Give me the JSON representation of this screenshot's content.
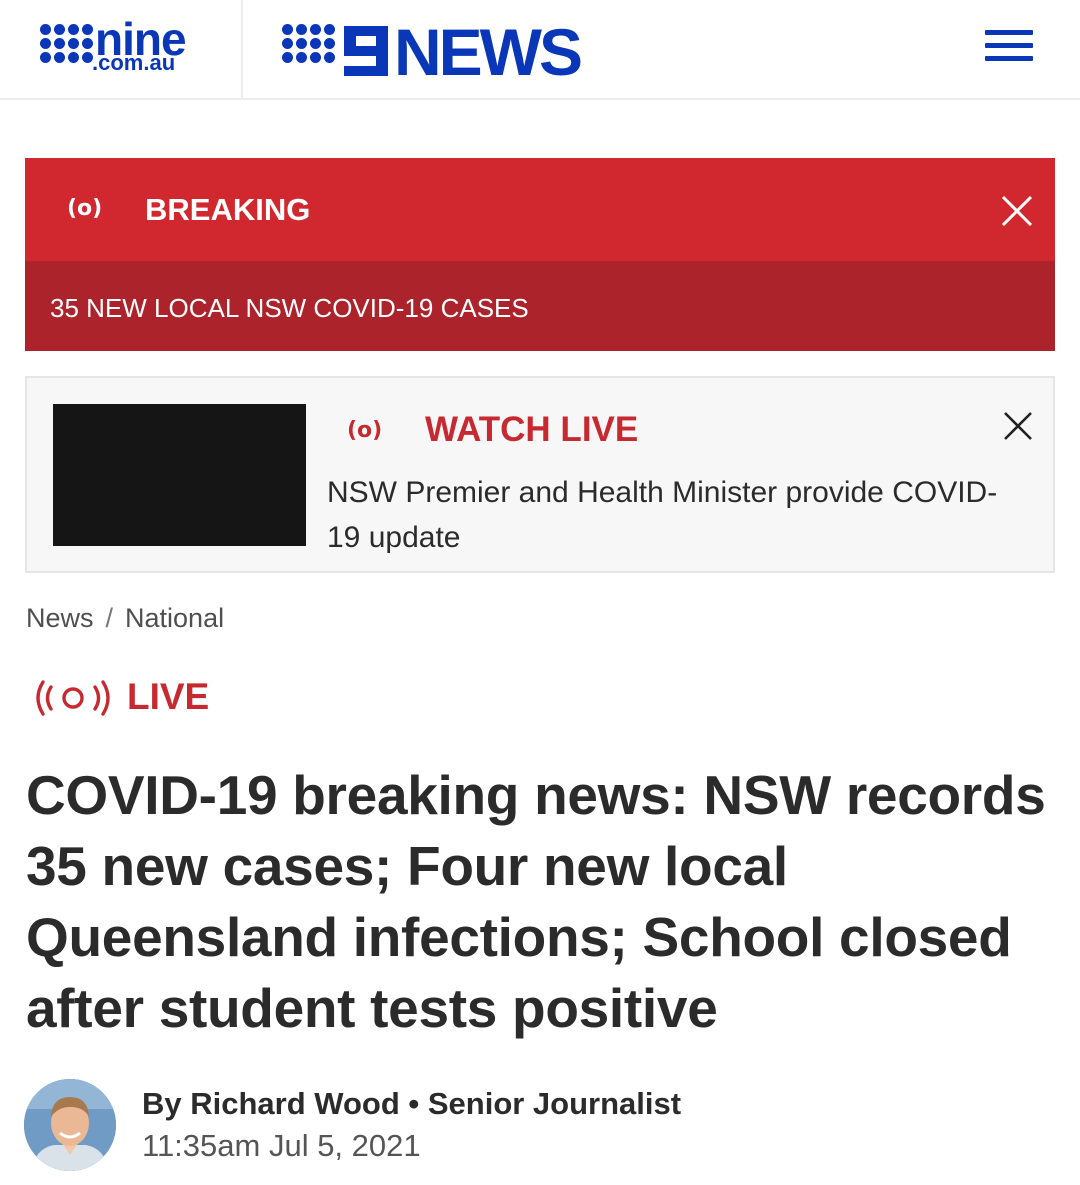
{
  "header": {
    "nine_logo_word": "nine",
    "nine_logo_sub": ".com.au",
    "news_logo_word": "NEWS",
    "brand_color": "#0a36b8"
  },
  "breaking": {
    "label": "BREAKING",
    "headline": "35 NEW LOCAL NSW COVID-19 CASES",
    "live_icon_text": "(o)",
    "color": "#d0282e"
  },
  "watch_live": {
    "label": "WATCH LIVE",
    "live_icon_text": "(o)",
    "description": "NSW Premier and Health Minister provide COVID-19 update"
  },
  "breadcrumb": {
    "items": [
      "News",
      "National"
    ],
    "separator": "/"
  },
  "live_badge": {
    "label": "LIVE"
  },
  "article": {
    "title": "COVID-19 breaking news: NSW records 35 new cases; Four new local Queensland infections; School closed after student tests positive",
    "author_line": "By Richard Wood • Senior Journalist",
    "timestamp": "11:35am Jul 5, 2021"
  }
}
